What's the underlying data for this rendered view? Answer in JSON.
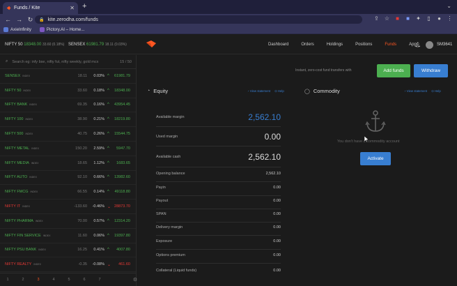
{
  "browser": {
    "tab_title": "Funds / Kite",
    "url": "kite.zerodha.com/funds",
    "new_tab": "+",
    "bookmarks": [
      {
        "label": "AxieInfinity",
        "color": "#5b7bd5"
      },
      {
        "label": "Pictory.AI – Home...",
        "color": "#7e57c2"
      }
    ]
  },
  "header": {
    "nifty": {
      "name": "NIFTY 50",
      "value": "18348.00",
      "change": "33.60 (0.18%)"
    },
    "sensex": {
      "name": "SENSEX",
      "value": "61981.79",
      "change": "18.11 (0.03%)"
    },
    "nav": [
      "Dashboard",
      "Orders",
      "Holdings",
      "Positions",
      "Funds",
      "Apps"
    ],
    "active_nav": "Funds",
    "user_id": "SM3641"
  },
  "watchlist": {
    "search_placeholder": "Search eg: infy bse, nifty fut, nifty weekly, gold mcx",
    "count": "15 / 50",
    "rows": [
      {
        "name": "SENSEX",
        "tag": "INDEX",
        "change": "18.11",
        "pct": "0.03%",
        "dir": "up",
        "price": "61981.79"
      },
      {
        "name": "NIFTY 50",
        "tag": "INDEX",
        "change": "33.60",
        "pct": "0.18%",
        "dir": "up",
        "price": "18348.00"
      },
      {
        "name": "NIFTY BANK",
        "tag": "INDEX",
        "change": "69.35",
        "pct": "0.16%",
        "dir": "up",
        "price": "43954.45"
      },
      {
        "name": "NIFTY 100",
        "tag": "INDEX",
        "change": "38.90",
        "pct": "0.21%",
        "dir": "up",
        "price": "18219.80"
      },
      {
        "name": "NIFTY 500",
        "tag": "INDEX",
        "change": "40.75",
        "pct": "0.26%",
        "dir": "up",
        "price": "15544.75"
      },
      {
        "name": "NIFTY METAL",
        "tag": "INDEX",
        "change": "150.20",
        "pct": "2.59%",
        "dir": "up",
        "price": "5947.70"
      },
      {
        "name": "NIFTY MEDIA",
        "tag": "INDEX",
        "change": "18.65",
        "pct": "1.12%",
        "dir": "up",
        "price": "1683.65"
      },
      {
        "name": "NIFTY AUTO",
        "tag": "INDEX",
        "change": "92.10",
        "pct": "0.66%",
        "dir": "up",
        "price": "13982.60"
      },
      {
        "name": "NIFTY FMCG",
        "tag": "INDEX",
        "change": "66.55",
        "pct": "0.14%",
        "dir": "up",
        "price": "49118.80"
      },
      {
        "name": "NIFTY IT",
        "tag": "INDEX",
        "change": "-133.60",
        "pct": "-0.46%",
        "dir": "down",
        "price": "28873.70"
      },
      {
        "name": "NIFTY PHARMA",
        "tag": "INDEX",
        "change": "70.00",
        "pct": "0.57%",
        "dir": "up",
        "price": "12314.20"
      },
      {
        "name": "NIFTY FIN SERVICE",
        "tag": "INDEX",
        "change": "11.60",
        "pct": "0.06%",
        "dir": "up",
        "price": "19397.80"
      },
      {
        "name": "NIFTY PSU BANK",
        "tag": "INDEX",
        "change": "16.25",
        "pct": "0.41%",
        "dir": "up",
        "price": "4007.80"
      },
      {
        "name": "NIFTY REALTY",
        "tag": "INDEX",
        "change": "-0.35",
        "pct": "-0.08%",
        "dir": "down",
        "price": "461.60"
      }
    ],
    "pages": [
      "1",
      "2",
      "3",
      "4",
      "5",
      "6",
      "7"
    ],
    "current_page": "3"
  },
  "funds": {
    "transfer_note": "Instant, zero-cost fund transfers with",
    "add_funds": "Add funds",
    "withdraw": "Withdraw",
    "equity": {
      "title": "Equity",
      "view_statement": "View statement",
      "help": "Help",
      "available_margin_label": "Available margin",
      "available_margin": "2,562.10",
      "used_margin_label": "Used margin",
      "used_margin": "0.00",
      "available_cash_label": "Available cash",
      "available_cash": "2,562.10",
      "details": [
        {
          "label": "Opening balance",
          "value": "2,562.10"
        },
        {
          "label": "Payin",
          "value": "0.00"
        },
        {
          "label": "Payout",
          "value": "0.00"
        },
        {
          "label": "SPAN",
          "value": "0.00"
        },
        {
          "label": "Delivery margin",
          "value": "0.00"
        },
        {
          "label": "Exposure",
          "value": "0.00"
        },
        {
          "label": "Options premium",
          "value": "0.00"
        },
        {
          "label": "Collateral (Liquid funds)",
          "value": "0.00"
        }
      ]
    },
    "commodity": {
      "title": "Commodity",
      "view_statement": "View statement",
      "help": "Help",
      "empty_message": "You don't have a commodity account",
      "activate": "Activate"
    }
  }
}
